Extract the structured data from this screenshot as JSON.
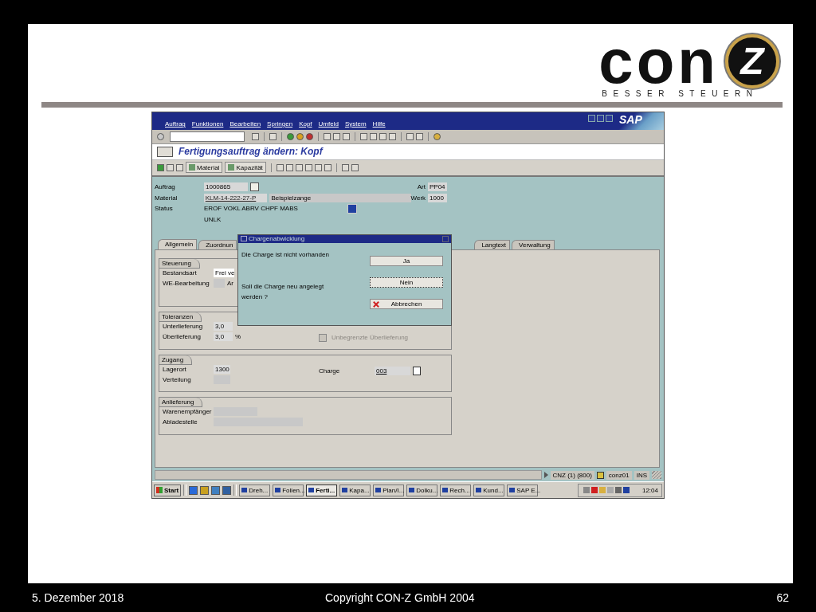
{
  "slide": {
    "logo": {
      "wordmark": "con",
      "emblem": "Z",
      "tagline": "BESSER STEUERN"
    },
    "footer": {
      "date": "5. Dezember 2018",
      "copyright": "Copyright CON-Z GmbH 2004",
      "page": "62"
    }
  },
  "sap": {
    "menu": [
      "Auftrag",
      "Funktionen",
      "Bearbeiten",
      "Springen",
      "Kopf",
      "Umfeld",
      "System",
      "Hilfe"
    ],
    "brand": "SAP",
    "title": "Fertigungsauftrag ändern: Kopf",
    "app_toolbar": [
      {
        "label": "Material"
      },
      {
        "label": "Kapazität"
      }
    ],
    "header": {
      "auftrag": {
        "label": "Auftrag",
        "value": "1000865"
      },
      "art": {
        "label": "Art",
        "value": "PP04"
      },
      "material": {
        "label": "Material",
        "value": "KLM-14-222-27-P",
        "description": "Beispielzange"
      },
      "werk": {
        "label": "Werk",
        "value": "1000"
      },
      "status": {
        "label": "Status",
        "lines": [
          "EROF VOKL ABRV CHPF MABS",
          "UNLK"
        ]
      }
    },
    "tabs": [
      {
        "label": "Allgemein",
        "selected": true
      },
      {
        "label": "Zuordnun",
        "selected": false
      },
      {
        "label": "Langtext",
        "selected": false
      },
      {
        "label": "Verwaltung",
        "selected": false
      }
    ],
    "groups": [
      {
        "title": "Steuerung",
        "rows": [
          {
            "label": "Bestandsart",
            "value": "Frei ve"
          },
          {
            "label": "WE-Bearbeitung",
            "after": "Ar"
          }
        ]
      },
      {
        "title": "Toleranzen",
        "rows": [
          {
            "label": "Unterlieferung",
            "value": "3,0"
          },
          {
            "label": "Überlieferung",
            "value": "3,0",
            "unit": "%"
          }
        ],
        "right": {
          "kind": "checkbox",
          "label": "Unbegrenzte Überlieferung",
          "checked": false,
          "disabled": true
        }
      },
      {
        "title": "Zugang",
        "rows": [
          {
            "label": "Lagerort",
            "value": "1300"
          },
          {
            "label": "Verteilung"
          }
        ],
        "right": {
          "kind": "field",
          "label": "Charge",
          "value": "003"
        }
      },
      {
        "title": "Anlieferung",
        "rows": [
          {
            "label": "Warenempfänger"
          },
          {
            "label": "Abladestelle"
          }
        ]
      }
    ],
    "dialog": {
      "title": "Chargenabwicklung",
      "messages": [
        "Die Charge ist nicht vorhanden",
        "Soll die Charge neu angelegt werden ?"
      ],
      "buttons": [
        {
          "label": "Ja",
          "focused": false
        },
        {
          "label": "Nein",
          "focused": true
        },
        {
          "label": "Abbrechen",
          "focused": false,
          "kind": "cancel"
        }
      ]
    },
    "status_bar": {
      "system": "CNZ (1) (800)",
      "user": "conz01",
      "mode": "INS"
    },
    "taskbar": {
      "start": "Start",
      "tasks": [
        {
          "label": "Dreh...",
          "selected": false
        },
        {
          "label": "Folien...",
          "selected": false
        },
        {
          "label": "Ferti...",
          "selected": true
        },
        {
          "label": "Kapa...",
          "selected": false
        },
        {
          "label": "Plan/I...",
          "selected": false
        },
        {
          "label": "Dolku...",
          "selected": false
        },
        {
          "label": "Rech...",
          "selected": false
        },
        {
          "label": "Kund...",
          "selected": false
        },
        {
          "label": "SAP E...",
          "selected": false
        }
      ],
      "clock": "12:04"
    }
  }
}
